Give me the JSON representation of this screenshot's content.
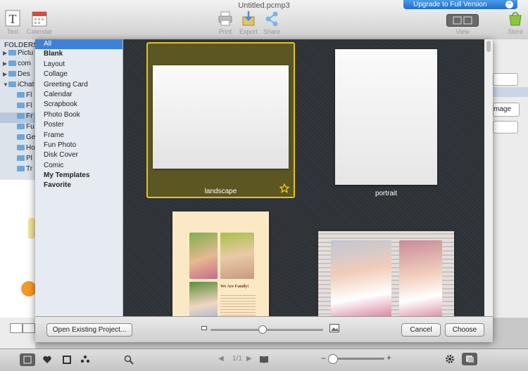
{
  "window": {
    "title": "Untitled.pcmp3"
  },
  "toolbar": {
    "text_label": "Text",
    "calendar_label": "Calendar",
    "print_label": "Print",
    "export_label": "Export",
    "share_label": "Share",
    "view_label": "View",
    "store_label": "Store",
    "upgrade_label": "Upgrade to Full Version"
  },
  "folders": {
    "header": "FOLDERS",
    "items": [
      {
        "label": "Pictu"
      },
      {
        "label": "com"
      },
      {
        "label": "Des"
      },
      {
        "label": "iChat"
      },
      {
        "label": "Fl"
      },
      {
        "label": "Fl"
      },
      {
        "label": "Fr"
      },
      {
        "label": "Fu"
      },
      {
        "label": "Ge"
      },
      {
        "label": "Ho"
      },
      {
        "label": "Pl"
      },
      {
        "label": "Tr"
      }
    ]
  },
  "categories": [
    {
      "label": "All",
      "selected": true
    },
    {
      "label": "Blank",
      "bold": true
    },
    {
      "label": "Layout"
    },
    {
      "label": "Collage"
    },
    {
      "label": "Greeting Card"
    },
    {
      "label": "Calendar"
    },
    {
      "label": "Scrapbook"
    },
    {
      "label": "Photo Book"
    },
    {
      "label": "Poster"
    },
    {
      "label": "Frame"
    },
    {
      "label": "Fun Photo"
    },
    {
      "label": "Disk Cover"
    },
    {
      "label": "Comic"
    },
    {
      "label": "My Templates",
      "bold": true
    },
    {
      "label": "Favorite",
      "bold": true
    }
  ],
  "templates": [
    {
      "label": "landscape",
      "selected": true
    },
    {
      "label": "portrait"
    }
  ],
  "greeting_card": {
    "heading": "We Are Family!"
  },
  "dialog": {
    "open_existing_label": "Open Existing Project...",
    "cancel_label": "Cancel",
    "choose_label": "Choose",
    "thumb_size": 0.46
  },
  "right_panel": {
    "image_label": "mage"
  },
  "bottom": {
    "page_indicator": "1/1"
  },
  "colors": {
    "accent": "#3d82d8",
    "selection_border": "#e8c21a"
  }
}
